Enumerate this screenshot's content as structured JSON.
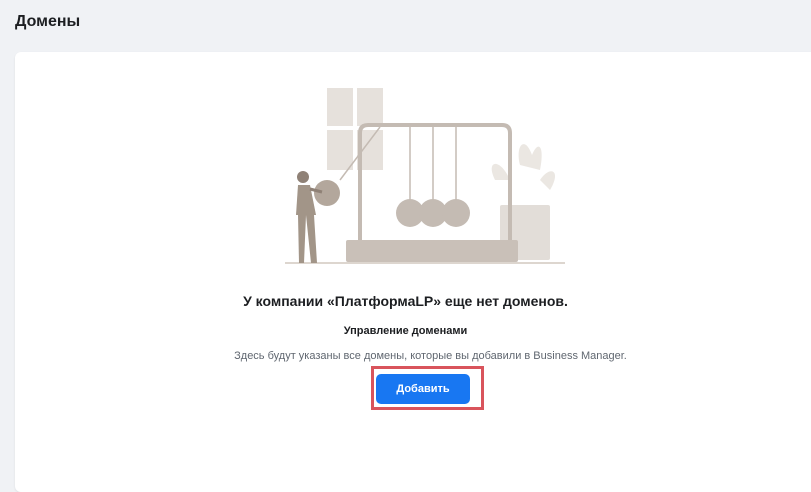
{
  "header": {
    "title": "Домены"
  },
  "empty_state": {
    "title": "У компании «ПлатформаLP» еще нет доменов.",
    "section_title": "Управление доменами",
    "description": "Здесь будут указаны все домены, которые вы добавили в Business Manager.",
    "add_button_label": "Добавить",
    "illustration_icon": "newtons-cradle-illustration"
  },
  "colors": {
    "page_background": "#f0f2f5",
    "card_background": "#ffffff",
    "primary_button": "#1877f2",
    "highlight_border": "#d9545c",
    "illustration_main": "#c9c0b8",
    "illustration_light": "#e8e4df"
  }
}
